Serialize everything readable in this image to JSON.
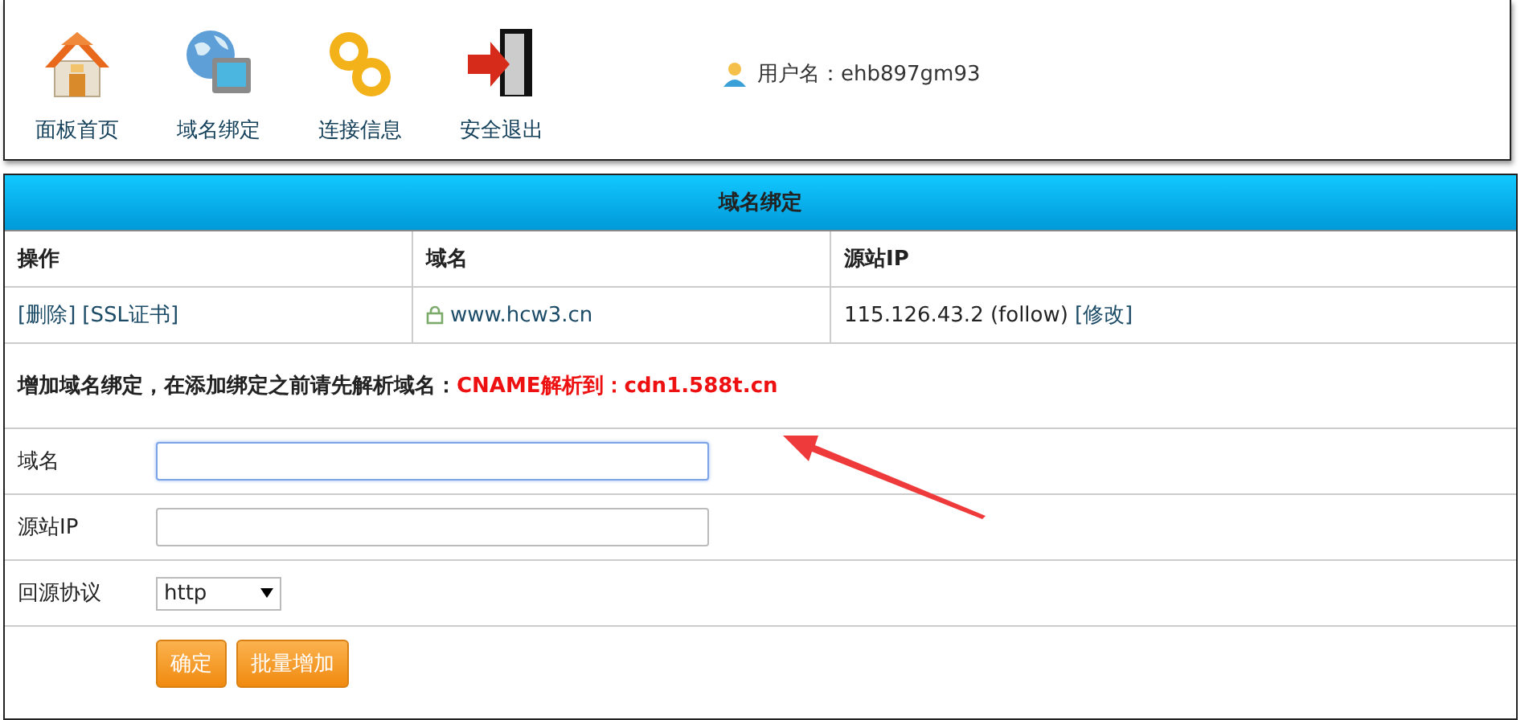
{
  "toolbar": {
    "items": [
      {
        "kind": "home",
        "label": "面板首页"
      },
      {
        "kind": "globe",
        "label": "域名绑定"
      },
      {
        "kind": "link",
        "label": "连接信息"
      },
      {
        "kind": "exit",
        "label": "安全退出"
      }
    ],
    "user": "用户名：ehb897gm93"
  },
  "panel": {
    "title": "域名绑定",
    "table": {
      "columns": [
        "操作",
        "域名",
        "源站IP"
      ],
      "rows": [
        {
          "actions": [
            "[删除]",
            "[SSL证书]"
          ],
          "domain": "www.hcw3.cn",
          "origin": "115.126.43.2 (follow)",
          "edit": "[修改]"
        }
      ]
    },
    "notice": {
      "text": "增加域名绑定，在添加绑定之前请先解析域名：",
      "highlight": "CNAME解析到：cdn1.588t.cn"
    },
    "form": [
      {
        "kind": "text",
        "label": "域名",
        "focused": true
      },
      {
        "kind": "text",
        "label": "源站IP",
        "focused": false
      },
      {
        "kind": "select",
        "label": "回源协议",
        "value": "http"
      }
    ],
    "buttons": [
      "确定",
      "批量增加"
    ]
  }
}
